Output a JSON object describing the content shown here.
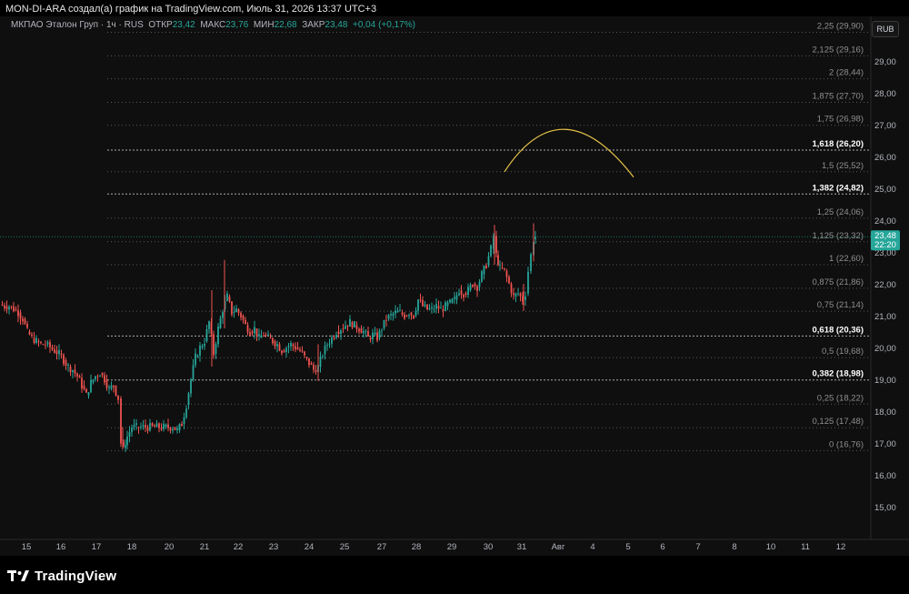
{
  "header": {
    "text": "MON-DI-ARA создал(а) график на TradingView.com, Июль 31, 2026 13:37 UTC+3"
  },
  "legend": {
    "symbol": "МКПАО Эталон Груп · 1ч · RUS",
    "open_label": "ОТКР",
    "open_value": "23,42",
    "high_label": "МАКС",
    "high_value": "23,76",
    "low_label": "МИН",
    "low_value": "22,68",
    "close_label": "ЗАКР",
    "close_value": "23,48",
    "change": "+0,04 (+0,17%)"
  },
  "currency_button": "RUB",
  "price_label": {
    "price": "23,48",
    "timer": "22:20"
  },
  "footer": {
    "brand": "TradingView"
  },
  "colors": {
    "up": "#26a69a",
    "down": "#ef5350",
    "background": "#0f0f0f",
    "fib_line": "#8a8a8a",
    "arc": "#e8c44a",
    "text": "#b2b5be"
  },
  "icons": {
    "logo": "tradingview-logo-icon"
  },
  "chart_data": {
    "type": "candlestick",
    "y_axis_ticks": [
      "29,00",
      "28,00",
      "27,00",
      "26,00",
      "25,00",
      "24,00",
      "23,00",
      "22,00",
      "21,00",
      "20,00",
      "19,00",
      "18,00",
      "17,00",
      "16,00",
      "15,00"
    ],
    "y_axis_values": [
      29,
      28,
      27,
      26,
      25,
      24,
      23,
      22,
      21,
      20,
      19,
      18,
      17,
      16,
      15
    ],
    "x_axis_ticks": [
      "15",
      "16",
      "17",
      "18",
      "20",
      "21",
      "22",
      "23",
      "24",
      "25",
      "27",
      "28",
      "29",
      "30",
      "31",
      "Авг",
      "4",
      "5",
      "6",
      "7",
      "8",
      "10",
      "11",
      "12"
    ],
    "ylim": [
      14.35,
      30.3
    ],
    "fib_levels": [
      {
        "label": "2,25 (29,90)",
        "value": 29.9,
        "bold": false
      },
      {
        "label": "2,125 (29,16)",
        "value": 29.16,
        "bold": false
      },
      {
        "label": "2 (28,44)",
        "value": 28.44,
        "bold": false
      },
      {
        "label": "1,875 (27,70)",
        "value": 27.7,
        "bold": false
      },
      {
        "label": "1,75 (26,98)",
        "value": 26.98,
        "bold": false
      },
      {
        "label": "1,618 (26,20)",
        "value": 26.2,
        "bold": true
      },
      {
        "label": "1,5 (25,52)",
        "value": 25.52,
        "bold": false
      },
      {
        "label": "1,382 (24,82)",
        "value": 24.82,
        "bold": true
      },
      {
        "label": "1,25 (24,06)",
        "value": 24.06,
        "bold": false
      },
      {
        "label": "1,125 (23,32)",
        "value": 23.32,
        "bold": false
      },
      {
        "label": "1 (22,60)",
        "value": 22.6,
        "bold": false
      },
      {
        "label": "0,875 (21,86)",
        "value": 21.86,
        "bold": false
      },
      {
        "label": "0,75 (21,14)",
        "value": 21.14,
        "bold": false
      },
      {
        "label": "0,618 (20,36)",
        "value": 20.36,
        "bold": true
      },
      {
        "label": "0,5 (19,68)",
        "value": 19.68,
        "bold": false
      },
      {
        "label": "0,382 (18,98)",
        "value": 18.98,
        "bold": true
      },
      {
        "label": "0,25 (18,22)",
        "value": 18.22,
        "bold": false
      },
      {
        "label": "0,125 (17,48)",
        "value": 17.48,
        "bold": false
      },
      {
        "label": "0 (16,76)",
        "value": 16.76,
        "bold": false
      }
    ],
    "current_price": 23.48,
    "price_path": [
      [
        0,
        21.35
      ],
      [
        5,
        21.3
      ],
      [
        10,
        21.3
      ],
      [
        15,
        21.2
      ],
      [
        20,
        21.1
      ],
      [
        25,
        20.9
      ],
      [
        30,
        20.5
      ],
      [
        35,
        20.3
      ],
      [
        40,
        20.2
      ],
      [
        45,
        20.1
      ],
      [
        50,
        20.1
      ],
      [
        55,
        20.0
      ],
      [
        60,
        19.9
      ],
      [
        65,
        19.8
      ],
      [
        70,
        19.6
      ],
      [
        75,
        19.4
      ],
      [
        80,
        19.3
      ],
      [
        85,
        19.1
      ],
      [
        90,
        18.8
      ],
      [
        95,
        18.5
      ],
      [
        100,
        18.9
      ],
      [
        105,
        19.1
      ],
      [
        110,
        19.2
      ],
      [
        115,
        19.0
      ],
      [
        120,
        18.7
      ],
      [
        125,
        18.8
      ],
      [
        130,
        18.4
      ],
      [
        133,
        17.0
      ],
      [
        136,
        16.85
      ],
      [
        140,
        17.2
      ],
      [
        145,
        17.5
      ],
      [
        150,
        17.5
      ],
      [
        160,
        17.5
      ],
      [
        170,
        17.5
      ],
      [
        180,
        17.5
      ],
      [
        190,
        17.5
      ],
      [
        195,
        17.4
      ],
      [
        200,
        17.6
      ],
      [
        205,
        18.2
      ],
      [
        210,
        19.0
      ],
      [
        215,
        19.7
      ],
      [
        220,
        20.0
      ],
      [
        225,
        20.2
      ],
      [
        230,
        20.8
      ],
      [
        235,
        19.8
      ],
      [
        240,
        20.6
      ],
      [
        245,
        21.2
      ],
      [
        250,
        21.6
      ],
      [
        255,
        21.1
      ],
      [
        260,
        21.2
      ],
      [
        265,
        21.0
      ],
      [
        270,
        20.7
      ],
      [
        275,
        20.5
      ],
      [
        280,
        20.6
      ],
      [
        285,
        20.3
      ],
      [
        290,
        20.4
      ],
      [
        295,
        20.3
      ],
      [
        300,
        20.2
      ],
      [
        305,
        20.1
      ],
      [
        310,
        19.9
      ],
      [
        315,
        20.0
      ],
      [
        320,
        20.1
      ],
      [
        325,
        20.0
      ],
      [
        330,
        19.9
      ],
      [
        335,
        19.7
      ],
      [
        340,
        19.5
      ],
      [
        345,
        19.3
      ],
      [
        350,
        19.4
      ],
      [
        355,
        19.8
      ],
      [
        360,
        20.1
      ],
      [
        365,
        20.3
      ],
      [
        370,
        20.5
      ],
      [
        375,
        20.6
      ],
      [
        380,
        20.7
      ],
      [
        385,
        20.8
      ],
      [
        390,
        20.7
      ],
      [
        395,
        20.6
      ],
      [
        400,
        20.5
      ],
      [
        405,
        20.3
      ],
      [
        410,
        20.4
      ],
      [
        415,
        20.3
      ],
      [
        420,
        20.6
      ],
      [
        425,
        20.9
      ],
      [
        430,
        21.0
      ],
      [
        435,
        21.1
      ],
      [
        440,
        21.1
      ],
      [
        445,
        21.0
      ],
      [
        450,
        21.1
      ],
      [
        455,
        21.0
      ],
      [
        460,
        21.5
      ],
      [
        465,
        21.3
      ],
      [
        470,
        21.2
      ],
      [
        475,
        21.2
      ],
      [
        480,
        21.3
      ],
      [
        485,
        21.2
      ],
      [
        490,
        21.3
      ],
      [
        495,
        21.4
      ],
      [
        500,
        21.5
      ],
      [
        505,
        21.8
      ],
      [
        510,
        21.7
      ],
      [
        515,
        21.8
      ],
      [
        520,
        22.0
      ],
      [
        525,
        21.9
      ],
      [
        530,
        22.3
      ],
      [
        535,
        22.6
      ],
      [
        540,
        23.1
      ],
      [
        543,
        23.5
      ],
      [
        546,
        22.9
      ],
      [
        550,
        22.5
      ],
      [
        555,
        22.4
      ],
      [
        560,
        22.0
      ],
      [
        565,
        21.6
      ],
      [
        570,
        21.7
      ],
      [
        575,
        21.5
      ],
      [
        578,
        21.7
      ],
      [
        581,
        22.4
      ],
      [
        584,
        22.9
      ],
      [
        587,
        23.4
      ],
      [
        589,
        23.48
      ]
    ],
    "arc": {
      "from": [
        555,
        25.52
      ],
      "peak": [
        622,
        26.85
      ],
      "to": [
        697,
        25.35
      ]
    }
  }
}
